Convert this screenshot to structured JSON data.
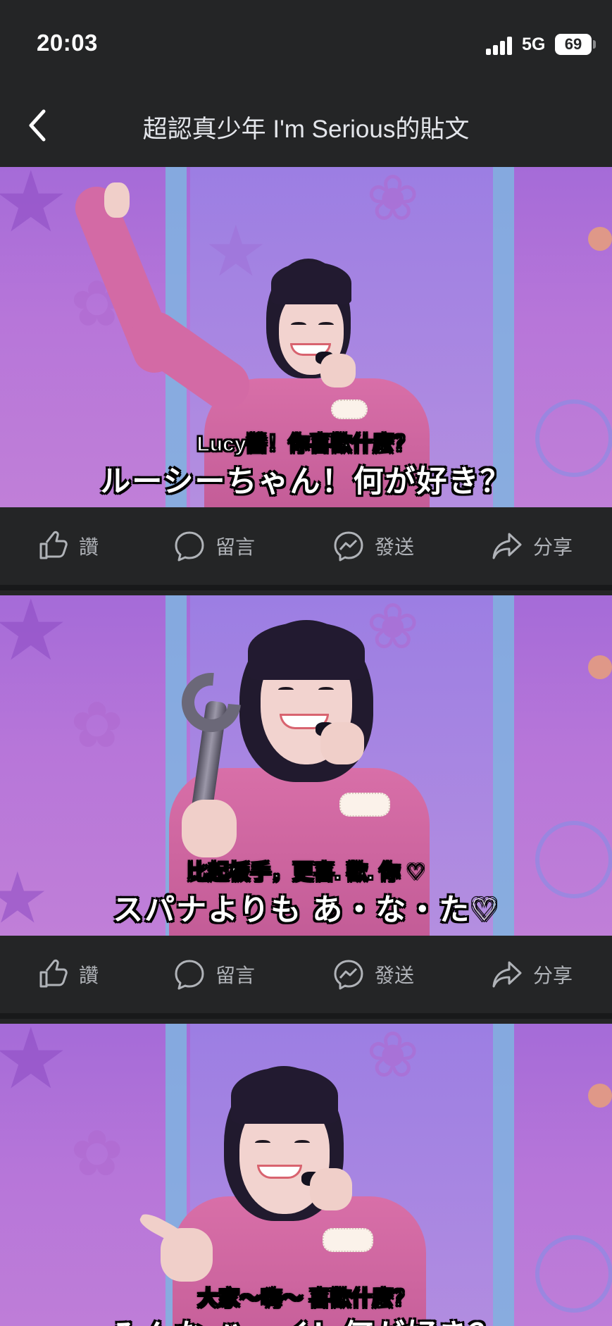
{
  "status_bar": {
    "time": "20:03",
    "network": "5G",
    "battery": "69"
  },
  "header": {
    "title": "超認真少年 I'm Serious的貼文",
    "back_icon": "chevron-left-icon"
  },
  "actions": {
    "like": "讚",
    "comment": "留言",
    "send": "發送",
    "share": "分享"
  },
  "posts": [
    {
      "subtitle_zh": "Lucy醬！你喜歡什麼？",
      "subtitle_jp": "ルーシーちゃん！何が好き？"
    },
    {
      "subtitle_zh": "比起板手，更喜. 歡. 你 ♡",
      "subtitle_jp": "スパナよりも あ・な・た♡"
    },
    {
      "subtitle_zh": "大家〜嗨〜 喜歡什麼？",
      "subtitle_jp": "みんな ハーイ！何が好き？"
    }
  ],
  "colors": {
    "background": "#242526",
    "text": "#e4e6eb",
    "action_text": "#b0b3b8",
    "photo_purple": "#b776d9",
    "shirt_pink": "#d86fa8"
  }
}
